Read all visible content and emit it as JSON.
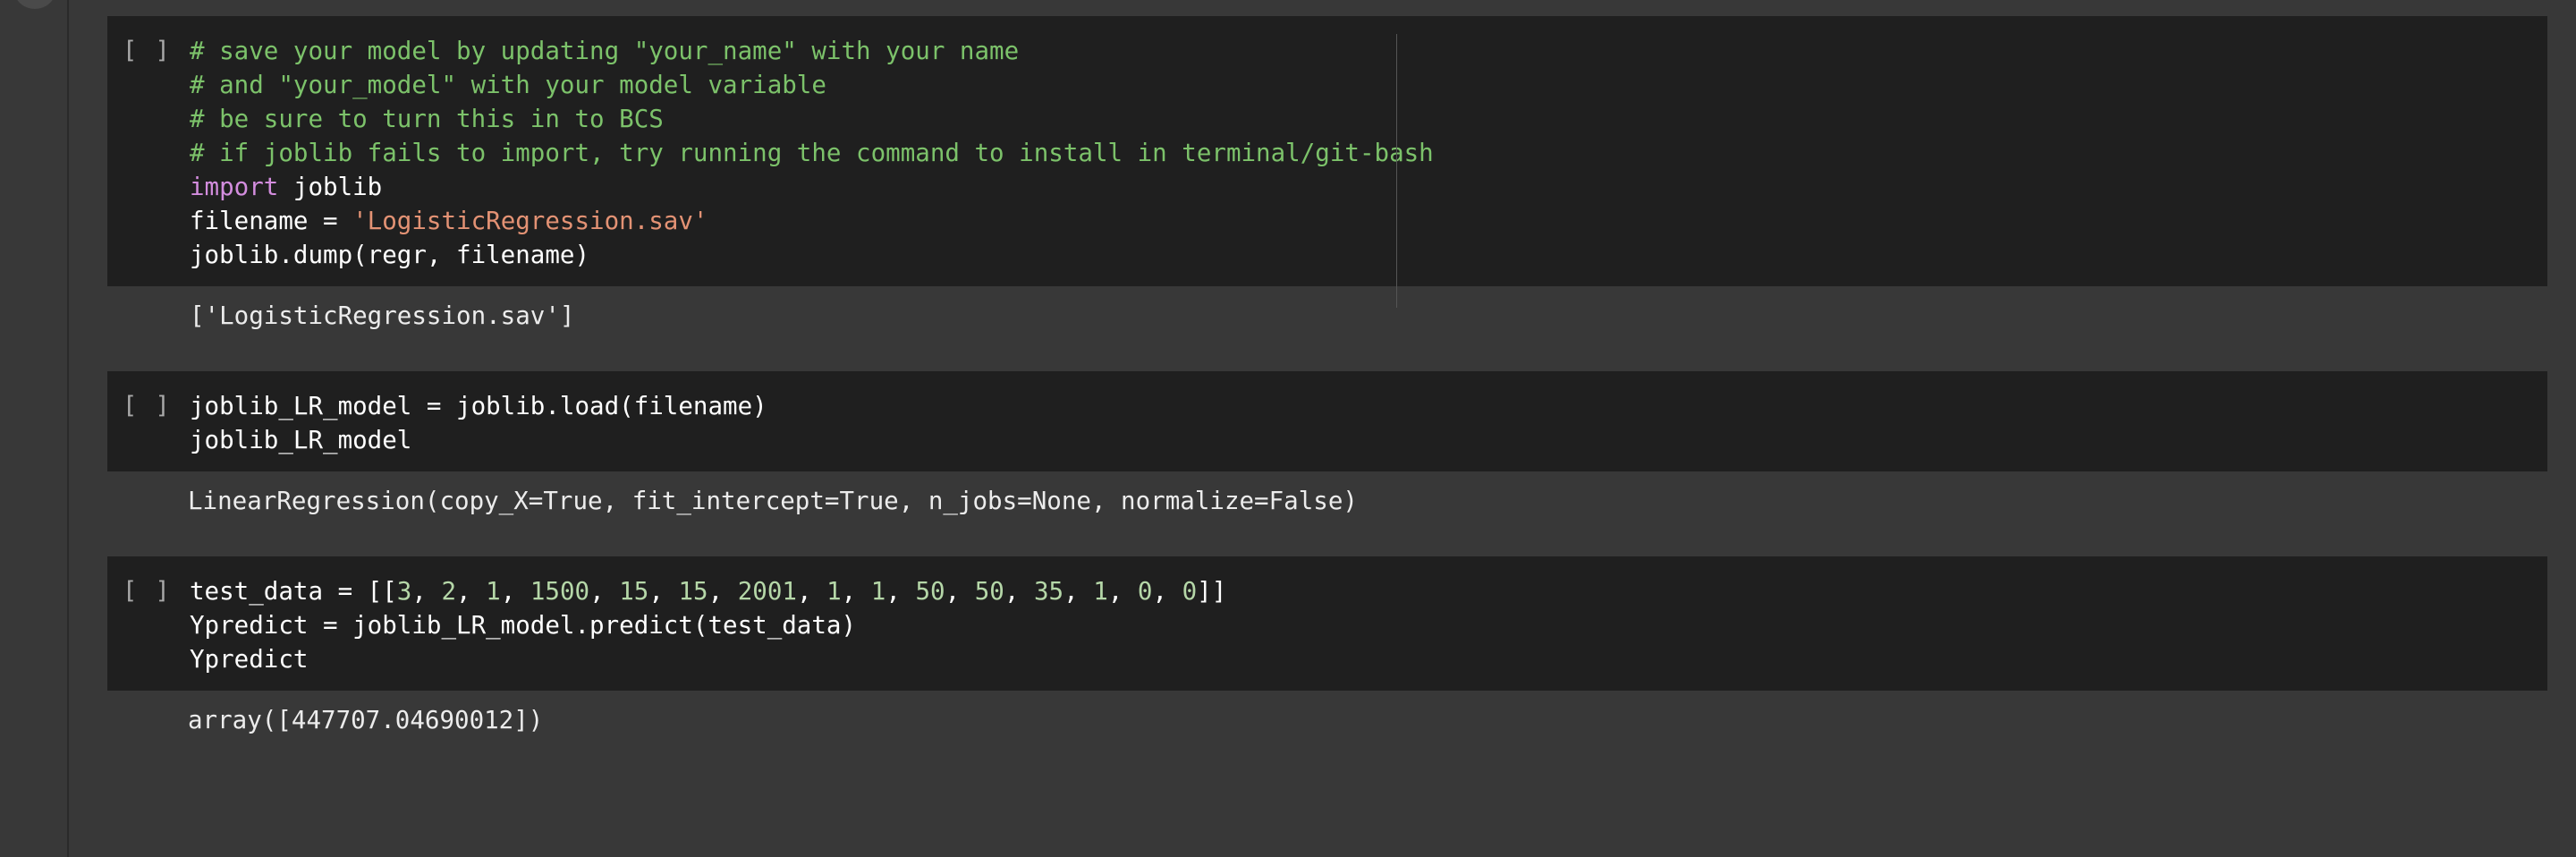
{
  "run_indicator": "[ ]",
  "cells": [
    {
      "lines": [
        {
          "tokens": [
            {
              "t": "comment",
              "v": "# save your model by updating \"your_name\" with your name"
            }
          ]
        },
        {
          "tokens": [
            {
              "t": "comment",
              "v": "# and \"your_model\" with your model variable"
            }
          ]
        },
        {
          "tokens": [
            {
              "t": "comment",
              "v": "# be sure to turn this in to BCS"
            }
          ]
        },
        {
          "tokens": [
            {
              "t": "comment",
              "v": "# if joblib fails to import, try running the command to install in terminal/git-bash"
            }
          ]
        },
        {
          "tokens": [
            {
              "t": "keyword",
              "v": "import"
            },
            {
              "t": "plain",
              "v": " joblib"
            }
          ]
        },
        {
          "tokens": [
            {
              "t": "plain",
              "v": "filename = "
            },
            {
              "t": "string",
              "v": "'LogisticRegression.sav'"
            }
          ]
        },
        {
          "tokens": [
            {
              "t": "plain",
              "v": "joblib.dump(regr, filename)"
            }
          ]
        }
      ],
      "output": "['LogisticRegression.sav']"
    },
    {
      "lines": [
        {
          "tokens": [
            {
              "t": "plain",
              "v": "joblib_LR_model = joblib.load(filename)"
            }
          ]
        },
        {
          "tokens": [
            {
              "t": "plain",
              "v": "joblib_LR_model"
            }
          ]
        }
      ],
      "output": "LinearRegression(copy_X=True, fit_intercept=True, n_jobs=None, normalize=False)"
    },
    {
      "lines": [
        {
          "tokens": [
            {
              "t": "plain",
              "v": "test_data = [["
            },
            {
              "t": "number",
              "v": "3"
            },
            {
              "t": "plain",
              "v": ", "
            },
            {
              "t": "number",
              "v": "2"
            },
            {
              "t": "plain",
              "v": ", "
            },
            {
              "t": "number",
              "v": "1"
            },
            {
              "t": "plain",
              "v": ", "
            },
            {
              "t": "number",
              "v": "1500"
            },
            {
              "t": "plain",
              "v": ", "
            },
            {
              "t": "number",
              "v": "15"
            },
            {
              "t": "plain",
              "v": ", "
            },
            {
              "t": "number",
              "v": "15"
            },
            {
              "t": "plain",
              "v": ", "
            },
            {
              "t": "number",
              "v": "2001"
            },
            {
              "t": "plain",
              "v": ", "
            },
            {
              "t": "number",
              "v": "1"
            },
            {
              "t": "plain",
              "v": ", "
            },
            {
              "t": "number",
              "v": "1"
            },
            {
              "t": "plain",
              "v": ", "
            },
            {
              "t": "number",
              "v": "50"
            },
            {
              "t": "plain",
              "v": ", "
            },
            {
              "t": "number",
              "v": "50"
            },
            {
              "t": "plain",
              "v": ", "
            },
            {
              "t": "number",
              "v": "35"
            },
            {
              "t": "plain",
              "v": ", "
            },
            {
              "t": "number",
              "v": "1"
            },
            {
              "t": "plain",
              "v": ", "
            },
            {
              "t": "number",
              "v": "0"
            },
            {
              "t": "plain",
              "v": ", "
            },
            {
              "t": "number",
              "v": "0"
            },
            {
              "t": "plain",
              "v": "]]"
            }
          ]
        },
        {
          "tokens": [
            {
              "t": "plain",
              "v": "Ypredict = joblib_LR_model.predict(test_data)"
            }
          ]
        },
        {
          "tokens": [
            {
              "t": "plain",
              "v": "Ypredict"
            }
          ]
        }
      ],
      "output": "array([447707.04690012])"
    }
  ],
  "colors": {
    "background": "#383838",
    "code_background": "#1f1f1f",
    "comment": "#7cc26a",
    "keyword": "#d38dde",
    "string": "#e39274",
    "number": "#b5d7a8"
  }
}
